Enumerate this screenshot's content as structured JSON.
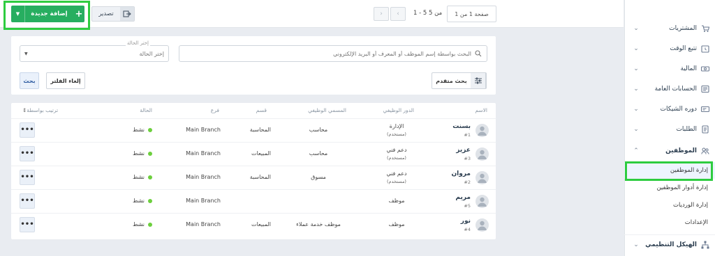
{
  "topbar": {
    "add_label": "إضافة جديدة",
    "export_label": "تصدير",
    "page_count": "1 - 5 من 5",
    "page_select": "صفحة 1 من 1"
  },
  "filter": {
    "search_placeholder": "البحث بواسطة إسم الموظف أو المعرف أو البريد الإلكتروني",
    "status_caption": "إختر الحالة",
    "status_value": "إختر الحالة",
    "advanced_label": "بحث متقدم",
    "clear_label": "إلغاء الفلتر",
    "search_label": "بحث"
  },
  "table": {
    "headers": {
      "name": "الاسم",
      "role": "الدور الوظيفي",
      "title": "المسمي الوظيفي",
      "department": "قسم",
      "branch": "فرع",
      "status": "الحالة",
      "sort": "ترتيب بواسطة"
    },
    "rows": [
      {
        "name": "بسنت",
        "id": "#1",
        "role": "الإدارة",
        "role_sub": "(مستخدم)",
        "title": "محاسب",
        "department": "المحاسبة",
        "branch": "Main Branch",
        "status": "نشط"
      },
      {
        "name": "عزيز",
        "id": "#3",
        "role": "دعم فني",
        "role_sub": "(مستخدم)",
        "title": "محاسب",
        "department": "المبيعات",
        "branch": "Main Branch",
        "status": "نشط"
      },
      {
        "name": "مروان",
        "id": "#2",
        "role": "دعم فني",
        "role_sub": "(مستخدم)",
        "title": "مسوق",
        "department": "المحاسبة",
        "branch": "Main Branch",
        "status": "نشط"
      },
      {
        "name": "مريم",
        "id": "#5",
        "role": "موظف",
        "role_sub": "",
        "title": "",
        "department": "",
        "branch": "Main Branch",
        "status": "نشط"
      },
      {
        "name": "نور",
        "id": "#4",
        "role": "موظف",
        "role_sub": "",
        "title": "موظف خدمة عملاء",
        "department": "المبيعات",
        "branch": "Main Branch",
        "status": "نشط"
      }
    ],
    "more_label": "•••"
  },
  "sidebar": {
    "items": [
      {
        "label": "المشتريات",
        "icon": "cart-icon"
      },
      {
        "label": "تتبع الوقت",
        "icon": "clock-icon"
      },
      {
        "label": "المالية",
        "icon": "money-icon"
      },
      {
        "label": "الحسابات العامة",
        "icon": "ledger-icon"
      },
      {
        "label": "دوره الشيكات",
        "icon": "check-icon"
      },
      {
        "label": "الطلبات",
        "icon": "orders-icon"
      },
      {
        "label": "الموظفين",
        "icon": "users-icon"
      }
    ],
    "subitems": [
      {
        "label": "إدارة الموظفين"
      },
      {
        "label": "إدارة أدوار الموظفين"
      },
      {
        "label": "إدارة الورديات"
      },
      {
        "label": "الإعدادات"
      }
    ],
    "bottom_item": {
      "label": "الهيكل التنظيمي",
      "icon": "org-chart-icon"
    }
  },
  "colors": {
    "accent_green": "#27ae60",
    "highlight": "#2ecc40",
    "status_dot": "#6ccf3d"
  }
}
